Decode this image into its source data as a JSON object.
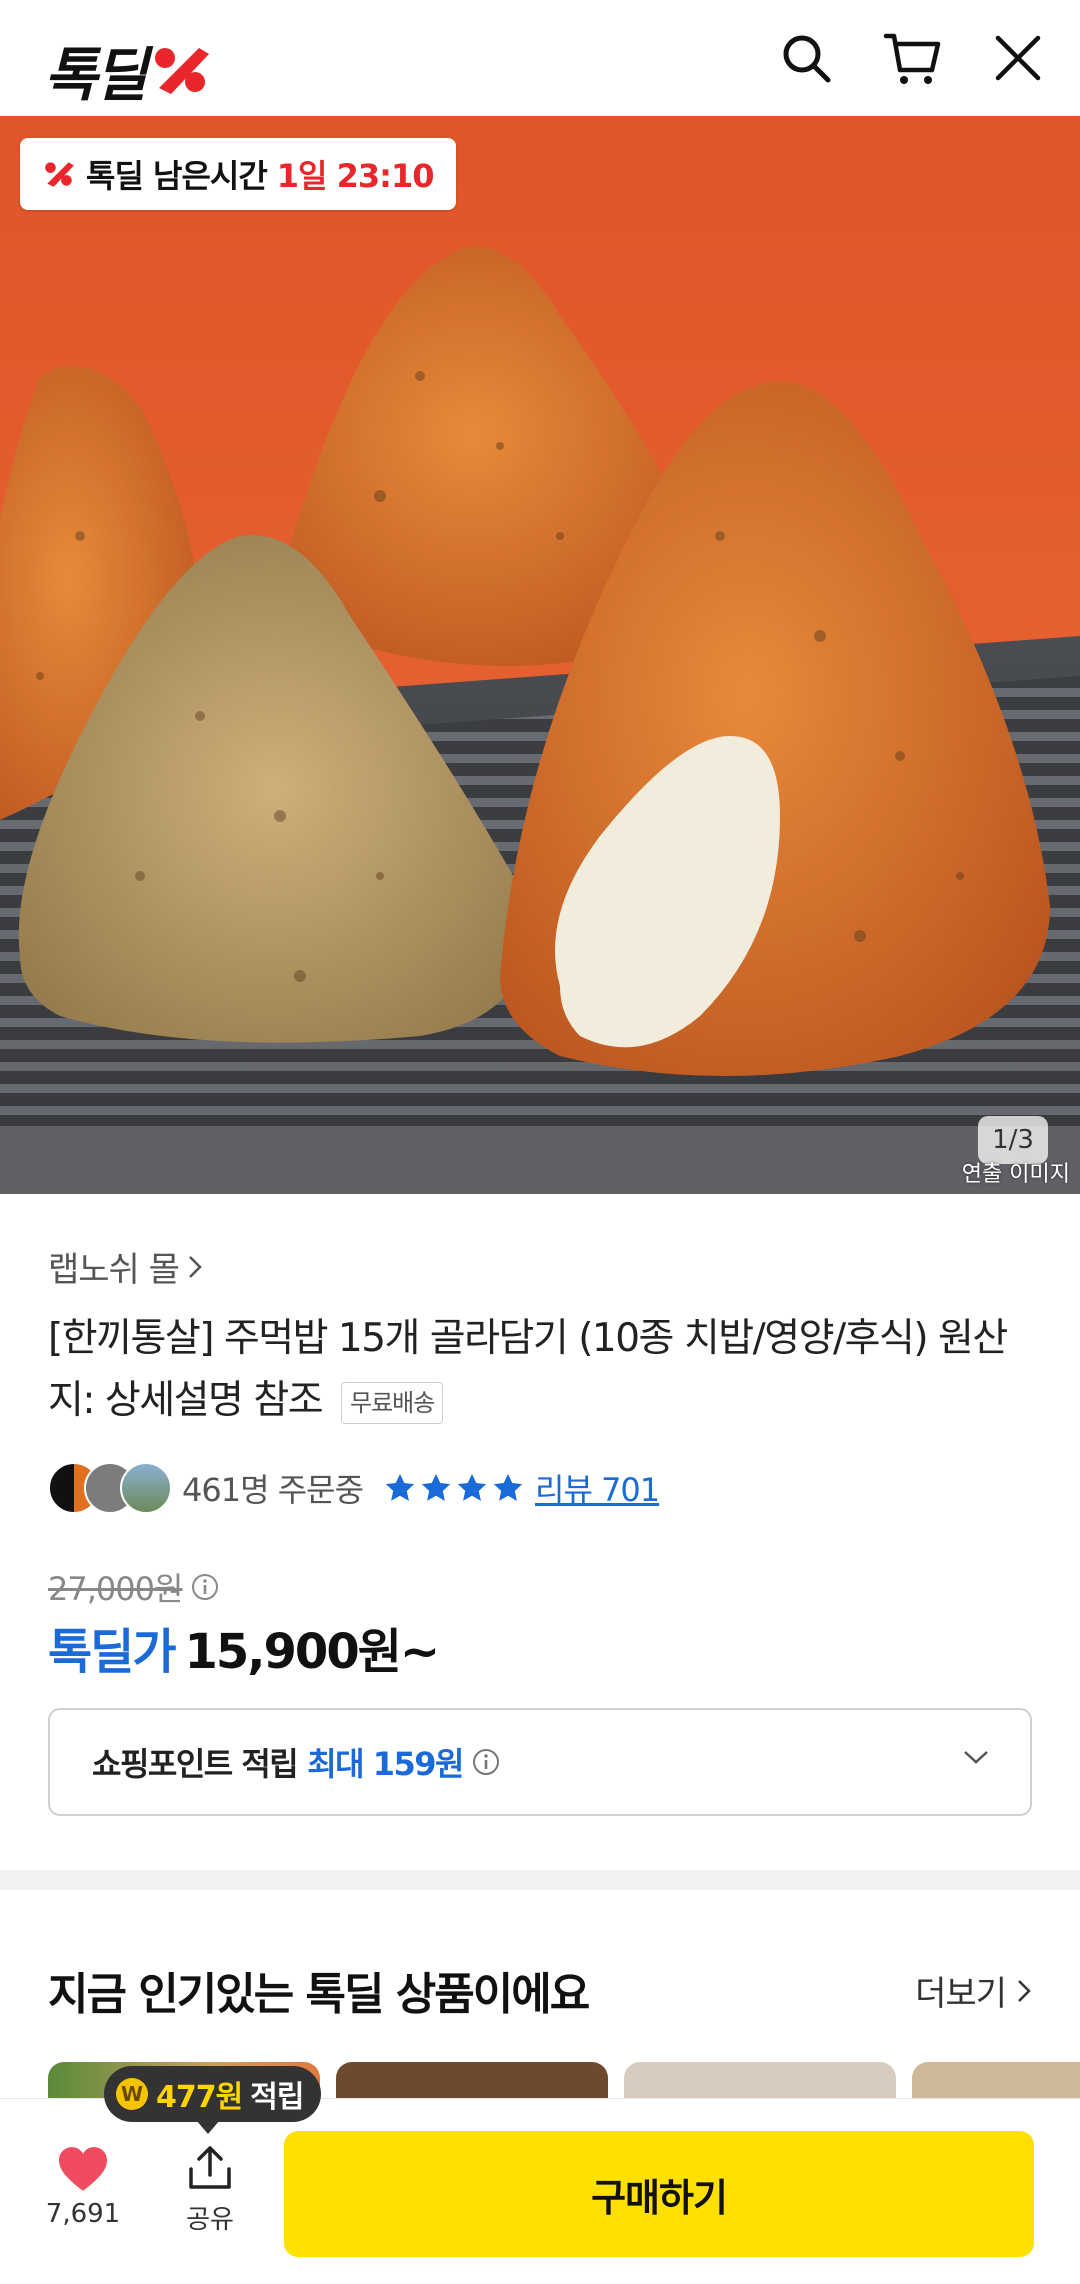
{
  "header": {
    "logo_text": "톡딜",
    "icons": [
      "search-icon",
      "cart-icon",
      "close-icon"
    ]
  },
  "hero": {
    "deal_timer_label": "톡딜 남은시간",
    "deal_timer_value": "1일 23:10",
    "page_indicator": "1/3",
    "caption": "연출 이미지"
  },
  "product": {
    "seller": "랩노쉬 몰",
    "title": "[한끼통살] 주먹밥 15개 골라담기 (10종 치밥/영양/후식) 원산지: 상세설명 참조",
    "free_shipping_badge": "무료배송",
    "order_count": "461명 주문중",
    "rating_stars": 4,
    "review_link": "리뷰 701",
    "original_price": "27,000원",
    "deal_price_label": "톡딜가",
    "deal_price": "15,900원~"
  },
  "points": {
    "label": "쇼핑포인트 적립",
    "value": "최대 159원"
  },
  "popular": {
    "title": "지금 인기있는 톡딜 상품이에요",
    "more": "더보기"
  },
  "bottom_bar": {
    "like_count": "7,691",
    "share_label": "공유",
    "buy_label": "구매하기",
    "reward_amount": "477원",
    "reward_suffix": "적립",
    "coin_symbol": "W"
  },
  "colors": {
    "accent_red": "#e8262b",
    "accent_blue": "#1a6ad8",
    "buy_yellow": "#ffe000"
  }
}
